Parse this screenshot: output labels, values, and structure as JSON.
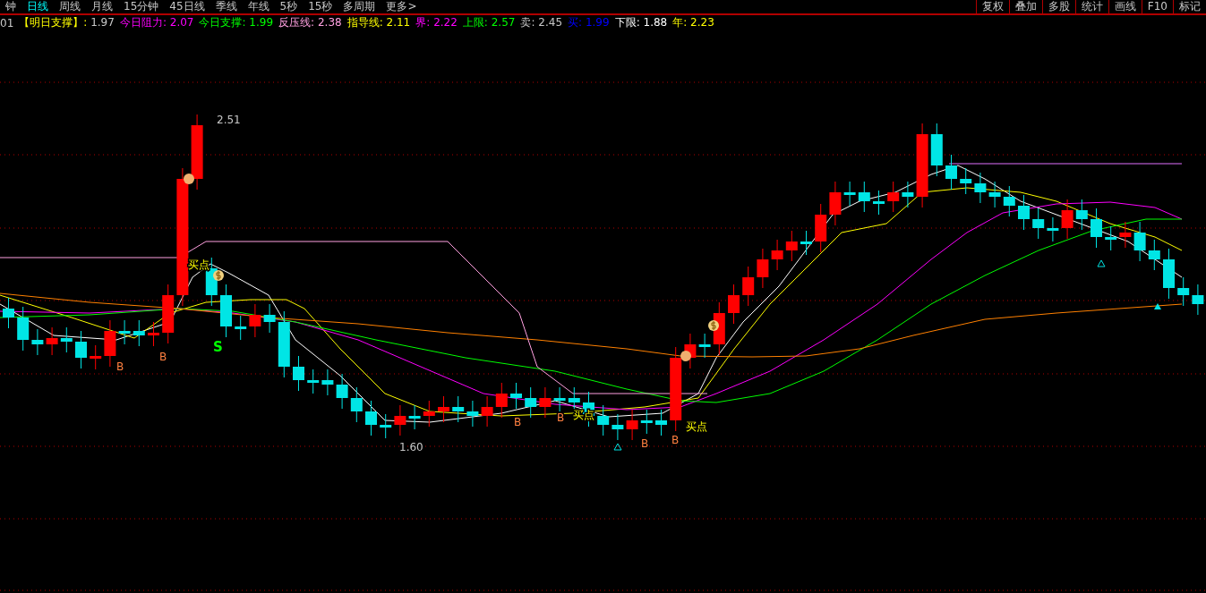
{
  "period_tabs": [
    {
      "label": "钟",
      "selected": false
    },
    {
      "label": "日线",
      "selected": true
    },
    {
      "label": "周线",
      "selected": false
    },
    {
      "label": "月线",
      "selected": false
    },
    {
      "label": "15分钟",
      "selected": false
    },
    {
      "label": "45日线",
      "selected": false
    },
    {
      "label": "季线",
      "selected": false
    },
    {
      "label": "年线",
      "selected": false
    },
    {
      "label": "5秒",
      "selected": false
    },
    {
      "label": "15秒",
      "selected": false
    },
    {
      "label": "多周期",
      "selected": false
    },
    {
      "label": "更多>",
      "selected": false
    }
  ],
  "toolbar_buttons": [
    "复权",
    "叠加",
    "多股",
    "统计",
    "画线",
    "F10",
    "标记"
  ],
  "indicator_prefix": "01",
  "indicators": [
    {
      "label": "【明日支撑】:",
      "value": "1.97",
      "color": "#ffff00"
    },
    {
      "label": "今日阻力:",
      "value": "2.07",
      "color": "#ff00ff"
    },
    {
      "label": "今日支撑:",
      "value": "1.99",
      "color": "#00ff00"
    },
    {
      "label": "反压线:",
      "value": "2.38",
      "color": "#ffa0e0"
    },
    {
      "label": "指导线:",
      "value": "2.11",
      "color": "#ffff00"
    },
    {
      "label": "界:",
      "value": "2.22",
      "color": "#ff00ff"
    },
    {
      "label": "上限:",
      "value": "2.57",
      "color": "#00ff00"
    },
    {
      "label": "卖:",
      "value": "2.45",
      "color": "#c8c8c8"
    },
    {
      "label": "买:",
      "value": "1.99",
      "color": "#0000ff"
    },
    {
      "label": "下限:",
      "value": "1.88",
      "color": "#ffffff"
    },
    {
      "label": "年:",
      "value": "2.23",
      "color": "#ffff00"
    }
  ],
  "chart_marks": [
    {
      "kind": "price",
      "text": "2.51"
    },
    {
      "kind": "price",
      "text": "1.60"
    },
    {
      "kind": "signal",
      "text": "买点"
    },
    {
      "kind": "signal",
      "text": "买点"
    },
    {
      "kind": "signal",
      "text": "买点"
    },
    {
      "kind": "buy",
      "text": "B"
    },
    {
      "kind": "buy",
      "text": "B"
    },
    {
      "kind": "buy",
      "text": "B"
    },
    {
      "kind": "buy",
      "text": "B"
    },
    {
      "kind": "buy",
      "text": "B"
    },
    {
      "kind": "buy",
      "text": "B"
    },
    {
      "kind": "sell",
      "text": "S"
    }
  ]
}
